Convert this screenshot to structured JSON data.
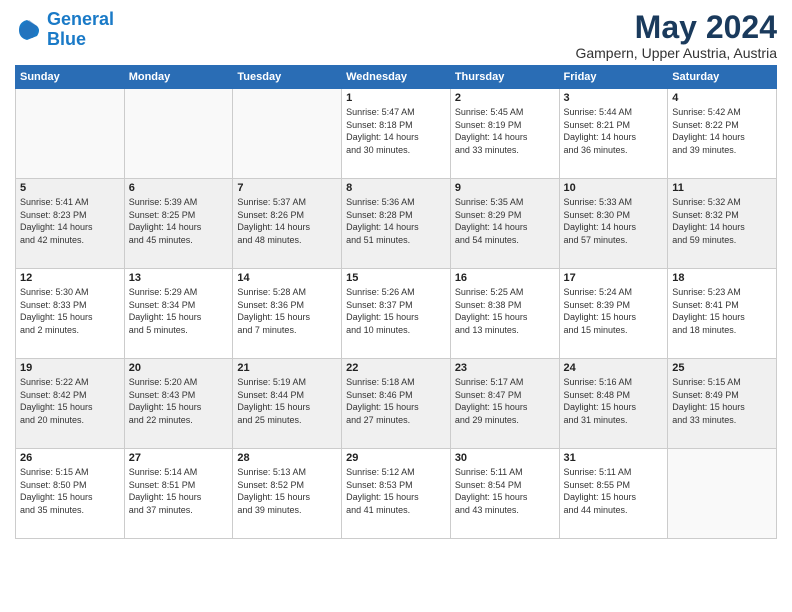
{
  "header": {
    "logo_line1": "General",
    "logo_line2": "Blue",
    "title": "May 2024",
    "subtitle": "Gampern, Upper Austria, Austria"
  },
  "days_of_week": [
    "Sunday",
    "Monday",
    "Tuesday",
    "Wednesday",
    "Thursday",
    "Friday",
    "Saturday"
  ],
  "weeks": [
    [
      {
        "day": "",
        "info": ""
      },
      {
        "day": "",
        "info": ""
      },
      {
        "day": "",
        "info": ""
      },
      {
        "day": "1",
        "info": "Sunrise: 5:47 AM\nSunset: 8:18 PM\nDaylight: 14 hours\nand 30 minutes."
      },
      {
        "day": "2",
        "info": "Sunrise: 5:45 AM\nSunset: 8:19 PM\nDaylight: 14 hours\nand 33 minutes."
      },
      {
        "day": "3",
        "info": "Sunrise: 5:44 AM\nSunset: 8:21 PM\nDaylight: 14 hours\nand 36 minutes."
      },
      {
        "day": "4",
        "info": "Sunrise: 5:42 AM\nSunset: 8:22 PM\nDaylight: 14 hours\nand 39 minutes."
      }
    ],
    [
      {
        "day": "5",
        "info": "Sunrise: 5:41 AM\nSunset: 8:23 PM\nDaylight: 14 hours\nand 42 minutes."
      },
      {
        "day": "6",
        "info": "Sunrise: 5:39 AM\nSunset: 8:25 PM\nDaylight: 14 hours\nand 45 minutes."
      },
      {
        "day": "7",
        "info": "Sunrise: 5:37 AM\nSunset: 8:26 PM\nDaylight: 14 hours\nand 48 minutes."
      },
      {
        "day": "8",
        "info": "Sunrise: 5:36 AM\nSunset: 8:28 PM\nDaylight: 14 hours\nand 51 minutes."
      },
      {
        "day": "9",
        "info": "Sunrise: 5:35 AM\nSunset: 8:29 PM\nDaylight: 14 hours\nand 54 minutes."
      },
      {
        "day": "10",
        "info": "Sunrise: 5:33 AM\nSunset: 8:30 PM\nDaylight: 14 hours\nand 57 minutes."
      },
      {
        "day": "11",
        "info": "Sunrise: 5:32 AM\nSunset: 8:32 PM\nDaylight: 14 hours\nand 59 minutes."
      }
    ],
    [
      {
        "day": "12",
        "info": "Sunrise: 5:30 AM\nSunset: 8:33 PM\nDaylight: 15 hours\nand 2 minutes."
      },
      {
        "day": "13",
        "info": "Sunrise: 5:29 AM\nSunset: 8:34 PM\nDaylight: 15 hours\nand 5 minutes."
      },
      {
        "day": "14",
        "info": "Sunrise: 5:28 AM\nSunset: 8:36 PM\nDaylight: 15 hours\nand 7 minutes."
      },
      {
        "day": "15",
        "info": "Sunrise: 5:26 AM\nSunset: 8:37 PM\nDaylight: 15 hours\nand 10 minutes."
      },
      {
        "day": "16",
        "info": "Sunrise: 5:25 AM\nSunset: 8:38 PM\nDaylight: 15 hours\nand 13 minutes."
      },
      {
        "day": "17",
        "info": "Sunrise: 5:24 AM\nSunset: 8:39 PM\nDaylight: 15 hours\nand 15 minutes."
      },
      {
        "day": "18",
        "info": "Sunrise: 5:23 AM\nSunset: 8:41 PM\nDaylight: 15 hours\nand 18 minutes."
      }
    ],
    [
      {
        "day": "19",
        "info": "Sunrise: 5:22 AM\nSunset: 8:42 PM\nDaylight: 15 hours\nand 20 minutes."
      },
      {
        "day": "20",
        "info": "Sunrise: 5:20 AM\nSunset: 8:43 PM\nDaylight: 15 hours\nand 22 minutes."
      },
      {
        "day": "21",
        "info": "Sunrise: 5:19 AM\nSunset: 8:44 PM\nDaylight: 15 hours\nand 25 minutes."
      },
      {
        "day": "22",
        "info": "Sunrise: 5:18 AM\nSunset: 8:46 PM\nDaylight: 15 hours\nand 27 minutes."
      },
      {
        "day": "23",
        "info": "Sunrise: 5:17 AM\nSunset: 8:47 PM\nDaylight: 15 hours\nand 29 minutes."
      },
      {
        "day": "24",
        "info": "Sunrise: 5:16 AM\nSunset: 8:48 PM\nDaylight: 15 hours\nand 31 minutes."
      },
      {
        "day": "25",
        "info": "Sunrise: 5:15 AM\nSunset: 8:49 PM\nDaylight: 15 hours\nand 33 minutes."
      }
    ],
    [
      {
        "day": "26",
        "info": "Sunrise: 5:15 AM\nSunset: 8:50 PM\nDaylight: 15 hours\nand 35 minutes."
      },
      {
        "day": "27",
        "info": "Sunrise: 5:14 AM\nSunset: 8:51 PM\nDaylight: 15 hours\nand 37 minutes."
      },
      {
        "day": "28",
        "info": "Sunrise: 5:13 AM\nSunset: 8:52 PM\nDaylight: 15 hours\nand 39 minutes."
      },
      {
        "day": "29",
        "info": "Sunrise: 5:12 AM\nSunset: 8:53 PM\nDaylight: 15 hours\nand 41 minutes."
      },
      {
        "day": "30",
        "info": "Sunrise: 5:11 AM\nSunset: 8:54 PM\nDaylight: 15 hours\nand 43 minutes."
      },
      {
        "day": "31",
        "info": "Sunrise: 5:11 AM\nSunset: 8:55 PM\nDaylight: 15 hours\nand 44 minutes."
      },
      {
        "day": "",
        "info": ""
      }
    ]
  ]
}
